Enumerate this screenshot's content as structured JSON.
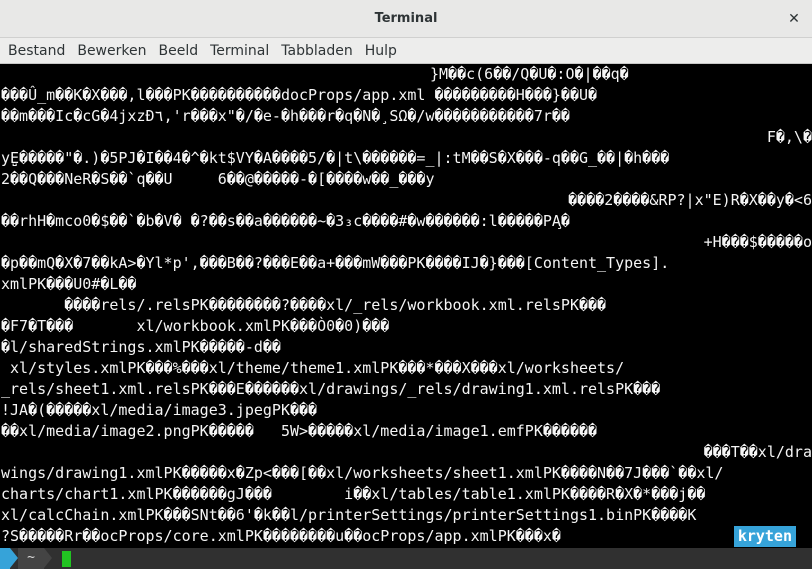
{
  "window": {
    "title": "Terminal",
    "close_glyph": "✕"
  },
  "menu": [
    "Bestand",
    "Bewerken",
    "Beeld",
    "Terminal",
    "Tabbladen",
    "Hulp"
  ],
  "terminal": {
    "lines": [
      {
        "text": "}M��c(6��/Q�U�:O�|��q�",
        "align": "right-ish"
      },
      {
        "text": "���Û_m��K�X���,l���PK����������docProps/app.xml ���������H���}��U�"
      },
      {
        "text": "��m���Ic�cG�4jxzĐ٦,'r���x\"�/�e-�h���r�q�N�¸SΩ�/w�����������7r��"
      },
      {
        "text": "F�,\\�",
        "align": "right"
      },
      {
        "text": "yE̺�����\"�.)�5PJ�I��4�^�kt$VY�A����5/�|t\\������=_|:tM��S�X���-q��G_��|�h���"
      },
      {
        "text": "2��Q���NeR�S��`q��U     6��@�����-�[����w��_���y"
      },
      {
        "text": "����2����&RP?|x\"E)R�X��y�<6",
        "align": "right"
      },
      {
        "text": "��rhH�mco0�$��`�b�V� �?��s��a������~�3₃c����#�w������:l�����PA̧�"
      },
      {
        "text": "+H���$�����o",
        "align": "right"
      },
      {
        "text": "�p��mQ�X�7��kA>�Yl*p',���B��?���E��a+���mW���PK����IJ�}���[Content_Types]."
      },
      {
        "text": "xmlPK���U0#�L��"
      },
      {
        "text": "       ����rels/.relsPK��������?����xl/_rels/workbook.xml.relsPK���"
      },
      {
        "text": "�F7�T���       xl/workbook.xmlPK���Ò0�0)���"
      },
      {
        "text": "�l/sharedStrings.xmlPK�����-d��"
      },
      {
        "text": " xl/styles.xmlPK���%���xl/theme/theme1.xmlPK���*���X���xl/worksheets/"
      },
      {
        "text": "_rels/sheet1.xml.relsPK���E������xl/drawings/_rels/drawing1.xml.relsPK���"
      },
      {
        "text": "!JA�(�����xl/media/image3.jpegPK���"
      },
      {
        "text": "��xl/media/image2.pngPK�����   5W>�����xl/media/image1.emfPK������"
      },
      {
        "text": "���T��xl/dra",
        "align": "right"
      },
      {
        "text": "wings/drawing1.xmlPK�����x�Zp<���[��xl/worksheets/sheet1.xmlPK����N��7J���`��xl/"
      },
      {
        "text": "charts/chart1.xmlPK������gJ���        i��xl/tables/table1.xmlPK����R�X�*���j��"
      },
      {
        "text": "xl/calcChain.xmlPK���SNt��6'�k��l/printerSettings/printerSettings1.binPK����K"
      },
      {
        "text": "?S�����Rr��ocProps/core.xmlPK��������u��ocProps/app.xmlPK���x�"
      }
    ],
    "hostname": "kryten"
  },
  "prompt": {
    "dir": "~"
  },
  "colors": {
    "accent": "#36a3d9",
    "cursor": "#22c422",
    "background": "#000000",
    "text": "#f5f5f5"
  }
}
